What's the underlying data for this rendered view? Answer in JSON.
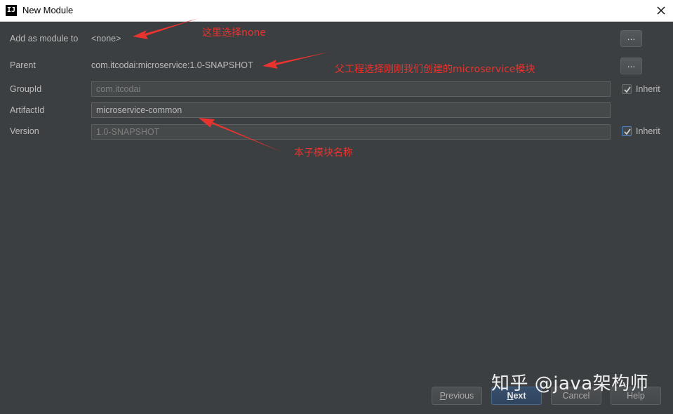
{
  "window": {
    "title": "New Module",
    "icon": "intellij-icon",
    "icon_text": "IJ"
  },
  "form": {
    "add_as_module": {
      "label": "Add as module to",
      "value": "<none>",
      "button": "..."
    },
    "parent": {
      "label": "Parent",
      "value": "com.itcodai:microservice:1.0-SNAPSHOT",
      "button": "..."
    },
    "group_id": {
      "label": "GroupId",
      "value": "com.itcodai",
      "inherit_label": "Inherit",
      "inherit_checked": true
    },
    "artifact_id": {
      "label": "ArtifactId",
      "value": "microservice-common"
    },
    "version": {
      "label": "Version",
      "value": "1.0-SNAPSHOT",
      "inherit_label": "Inherit",
      "inherit_checked": true
    }
  },
  "annotations": {
    "a1": "这里选择none",
    "a2": "父工程选择刚刚我们创建的microservice模块",
    "a3": "本子模块名称"
  },
  "footer": {
    "previous": "Previous",
    "next": "Next",
    "cancel": "Cancel",
    "help": "Help"
  },
  "watermark": "知乎 @java架构师",
  "colors": {
    "background": "#3c3f41",
    "annotation": "#e8332f",
    "primary_button": "#365880"
  }
}
